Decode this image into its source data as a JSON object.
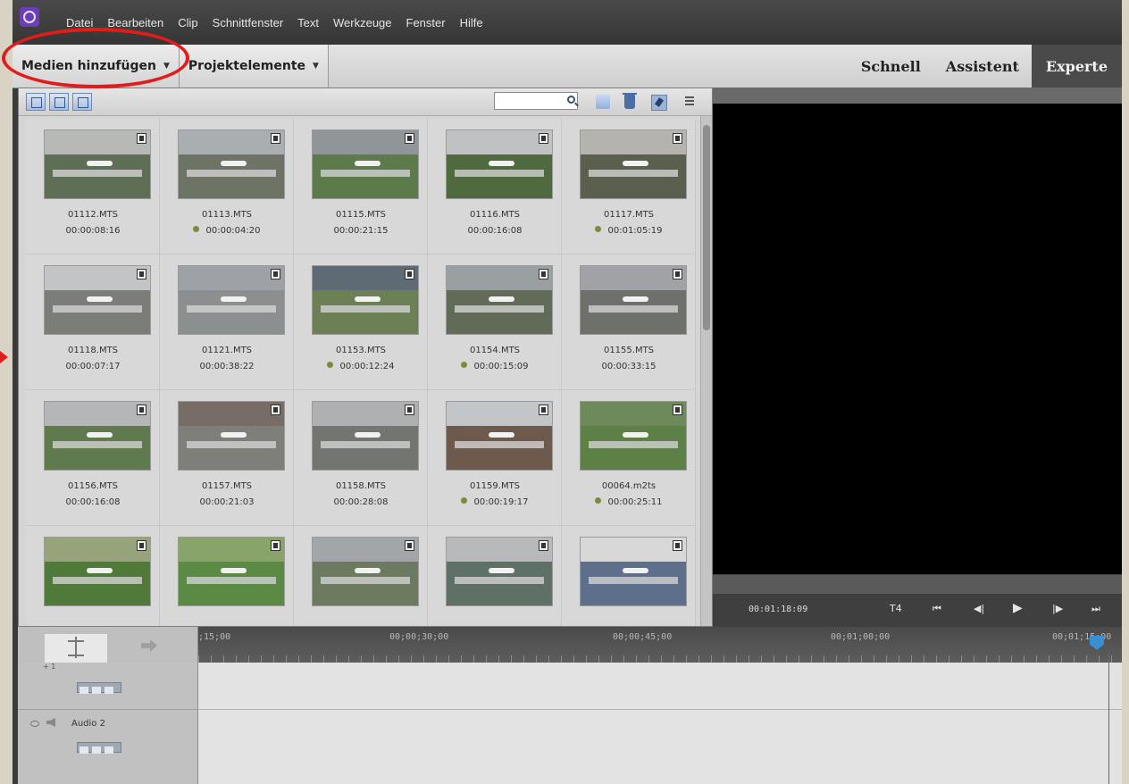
{
  "menubar": {
    "items": [
      "Datei",
      "Bearbeiten",
      "Clip",
      "Schnittfenster",
      "Text",
      "Werkzeuge",
      "Fenster",
      "Hilfe"
    ]
  },
  "modebar": {
    "add_media_label": "Medien hinzufügen",
    "project_assets_label": "Projektelemente",
    "modes": [
      "Schnell",
      "Assistent",
      "Experte"
    ],
    "active_mode": "Experte"
  },
  "assets": {
    "search_placeholder": "",
    "clips": [
      {
        "name": "01112.MTS",
        "duration": "00:00:08:16",
        "used": false
      },
      {
        "name": "01113.MTS",
        "duration": "00:00:04:20",
        "used": true
      },
      {
        "name": "01115.MTS",
        "duration": "00:00:21:15",
        "used": false
      },
      {
        "name": "01116.MTS",
        "duration": "00:00:16:08",
        "used": false
      },
      {
        "name": "01117.MTS",
        "duration": "00:01:05:19",
        "used": true
      },
      {
        "name": "01118.MTS",
        "duration": "00:00:07:17",
        "used": false
      },
      {
        "name": "01121.MTS",
        "duration": "00:00:38:22",
        "used": false
      },
      {
        "name": "01153.MTS",
        "duration": "00:00:12:24",
        "used": true
      },
      {
        "name": "01154.MTS",
        "duration": "00:00:15:09",
        "used": true
      },
      {
        "name": "01155.MTS",
        "duration": "00:00:33:15",
        "used": false
      },
      {
        "name": "01156.MTS",
        "duration": "00:00:16:08",
        "used": false
      },
      {
        "name": "01157.MTS",
        "duration": "00:00:21:03",
        "used": false
      },
      {
        "name": "01158.MTS",
        "duration": "00:00:28:08",
        "used": false
      },
      {
        "name": "01159.MTS",
        "duration": "00:00:19:17",
        "used": true
      },
      {
        "name": "00064.m2ts",
        "duration": "00:00:25:11",
        "used": true
      },
      {
        "name": "",
        "duration": "",
        "used": false
      },
      {
        "name": "",
        "duration": "",
        "used": false
      },
      {
        "name": "",
        "duration": "",
        "used": false
      },
      {
        "name": "",
        "duration": "",
        "used": false
      },
      {
        "name": "",
        "duration": "",
        "used": false
      }
    ]
  },
  "monitor": {
    "timecode": "00:01:18:09",
    "controls": [
      "T4",
      "⏮",
      "◀|",
      "▶",
      "|▶",
      "⏭"
    ]
  },
  "timeline": {
    "ruler_labels": [
      ";15;00",
      "00;00;30;00",
      "00;00;45;00",
      "00;01;00;00",
      "00;01;15;00"
    ],
    "tracks": [
      {
        "name": "",
        "top_label": "+ 1"
      },
      {
        "name": "Audio 2",
        "top_label": ""
      }
    ]
  },
  "colors": {
    "highlight": "#e21b1b",
    "active_mode_bg": "#4a4a4a",
    "used_dot": "#7d8a3a",
    "playhead": "#3a8fd0"
  }
}
